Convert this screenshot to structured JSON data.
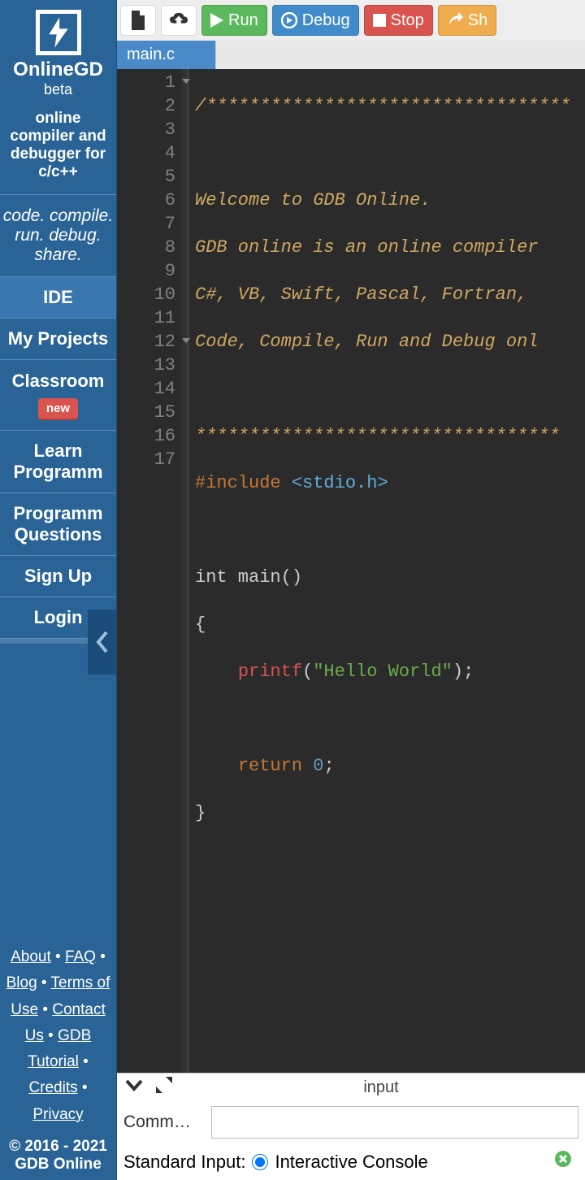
{
  "sidebar": {
    "brand": "OnlineGD",
    "brand_sub": "beta",
    "tagline": "online compiler and debugger for c/c++",
    "slogan": "code. compile. run. debug. share.",
    "nav": [
      {
        "label": "IDE",
        "active": true
      },
      {
        "label": "My Projects"
      },
      {
        "label": "Classroom",
        "badge": "new"
      },
      {
        "label": "Learn Programm"
      },
      {
        "label": "Programm Questions"
      },
      {
        "label": "Sign Up"
      },
      {
        "label": "Login"
      }
    ],
    "footer_links": [
      "About",
      "FAQ",
      "Blog",
      "Terms of Use",
      "Contact Us",
      "GDB Tutorial",
      "Credits",
      "Privacy"
    ],
    "copyright": "© 2016 - 2021 GDB Online"
  },
  "toolbar": {
    "run": "Run",
    "debug": "Debug",
    "stop": "Stop",
    "share": "Sh"
  },
  "tabs": {
    "file": "main.c"
  },
  "code": {
    "lines": [
      "/**********************************",
      "",
      "Welcome to GDB Online.",
      "GDB online is an online compiler",
      "C#, VB, Swift, Pascal, Fortran, ",
      "Code, Compile, Run and Debug onl",
      "",
      "**********************************",
      "#include <stdio.h>",
      "",
      "int main()",
      "{",
      "    printf(\"Hello World\");",
      "",
      "    return 0;",
      "}",
      ""
    ]
  },
  "bottom": {
    "title": "input",
    "cmd_label": "Comm…",
    "stdin_label": "Standard Input:",
    "stdin_opt": "Interactive Console"
  }
}
